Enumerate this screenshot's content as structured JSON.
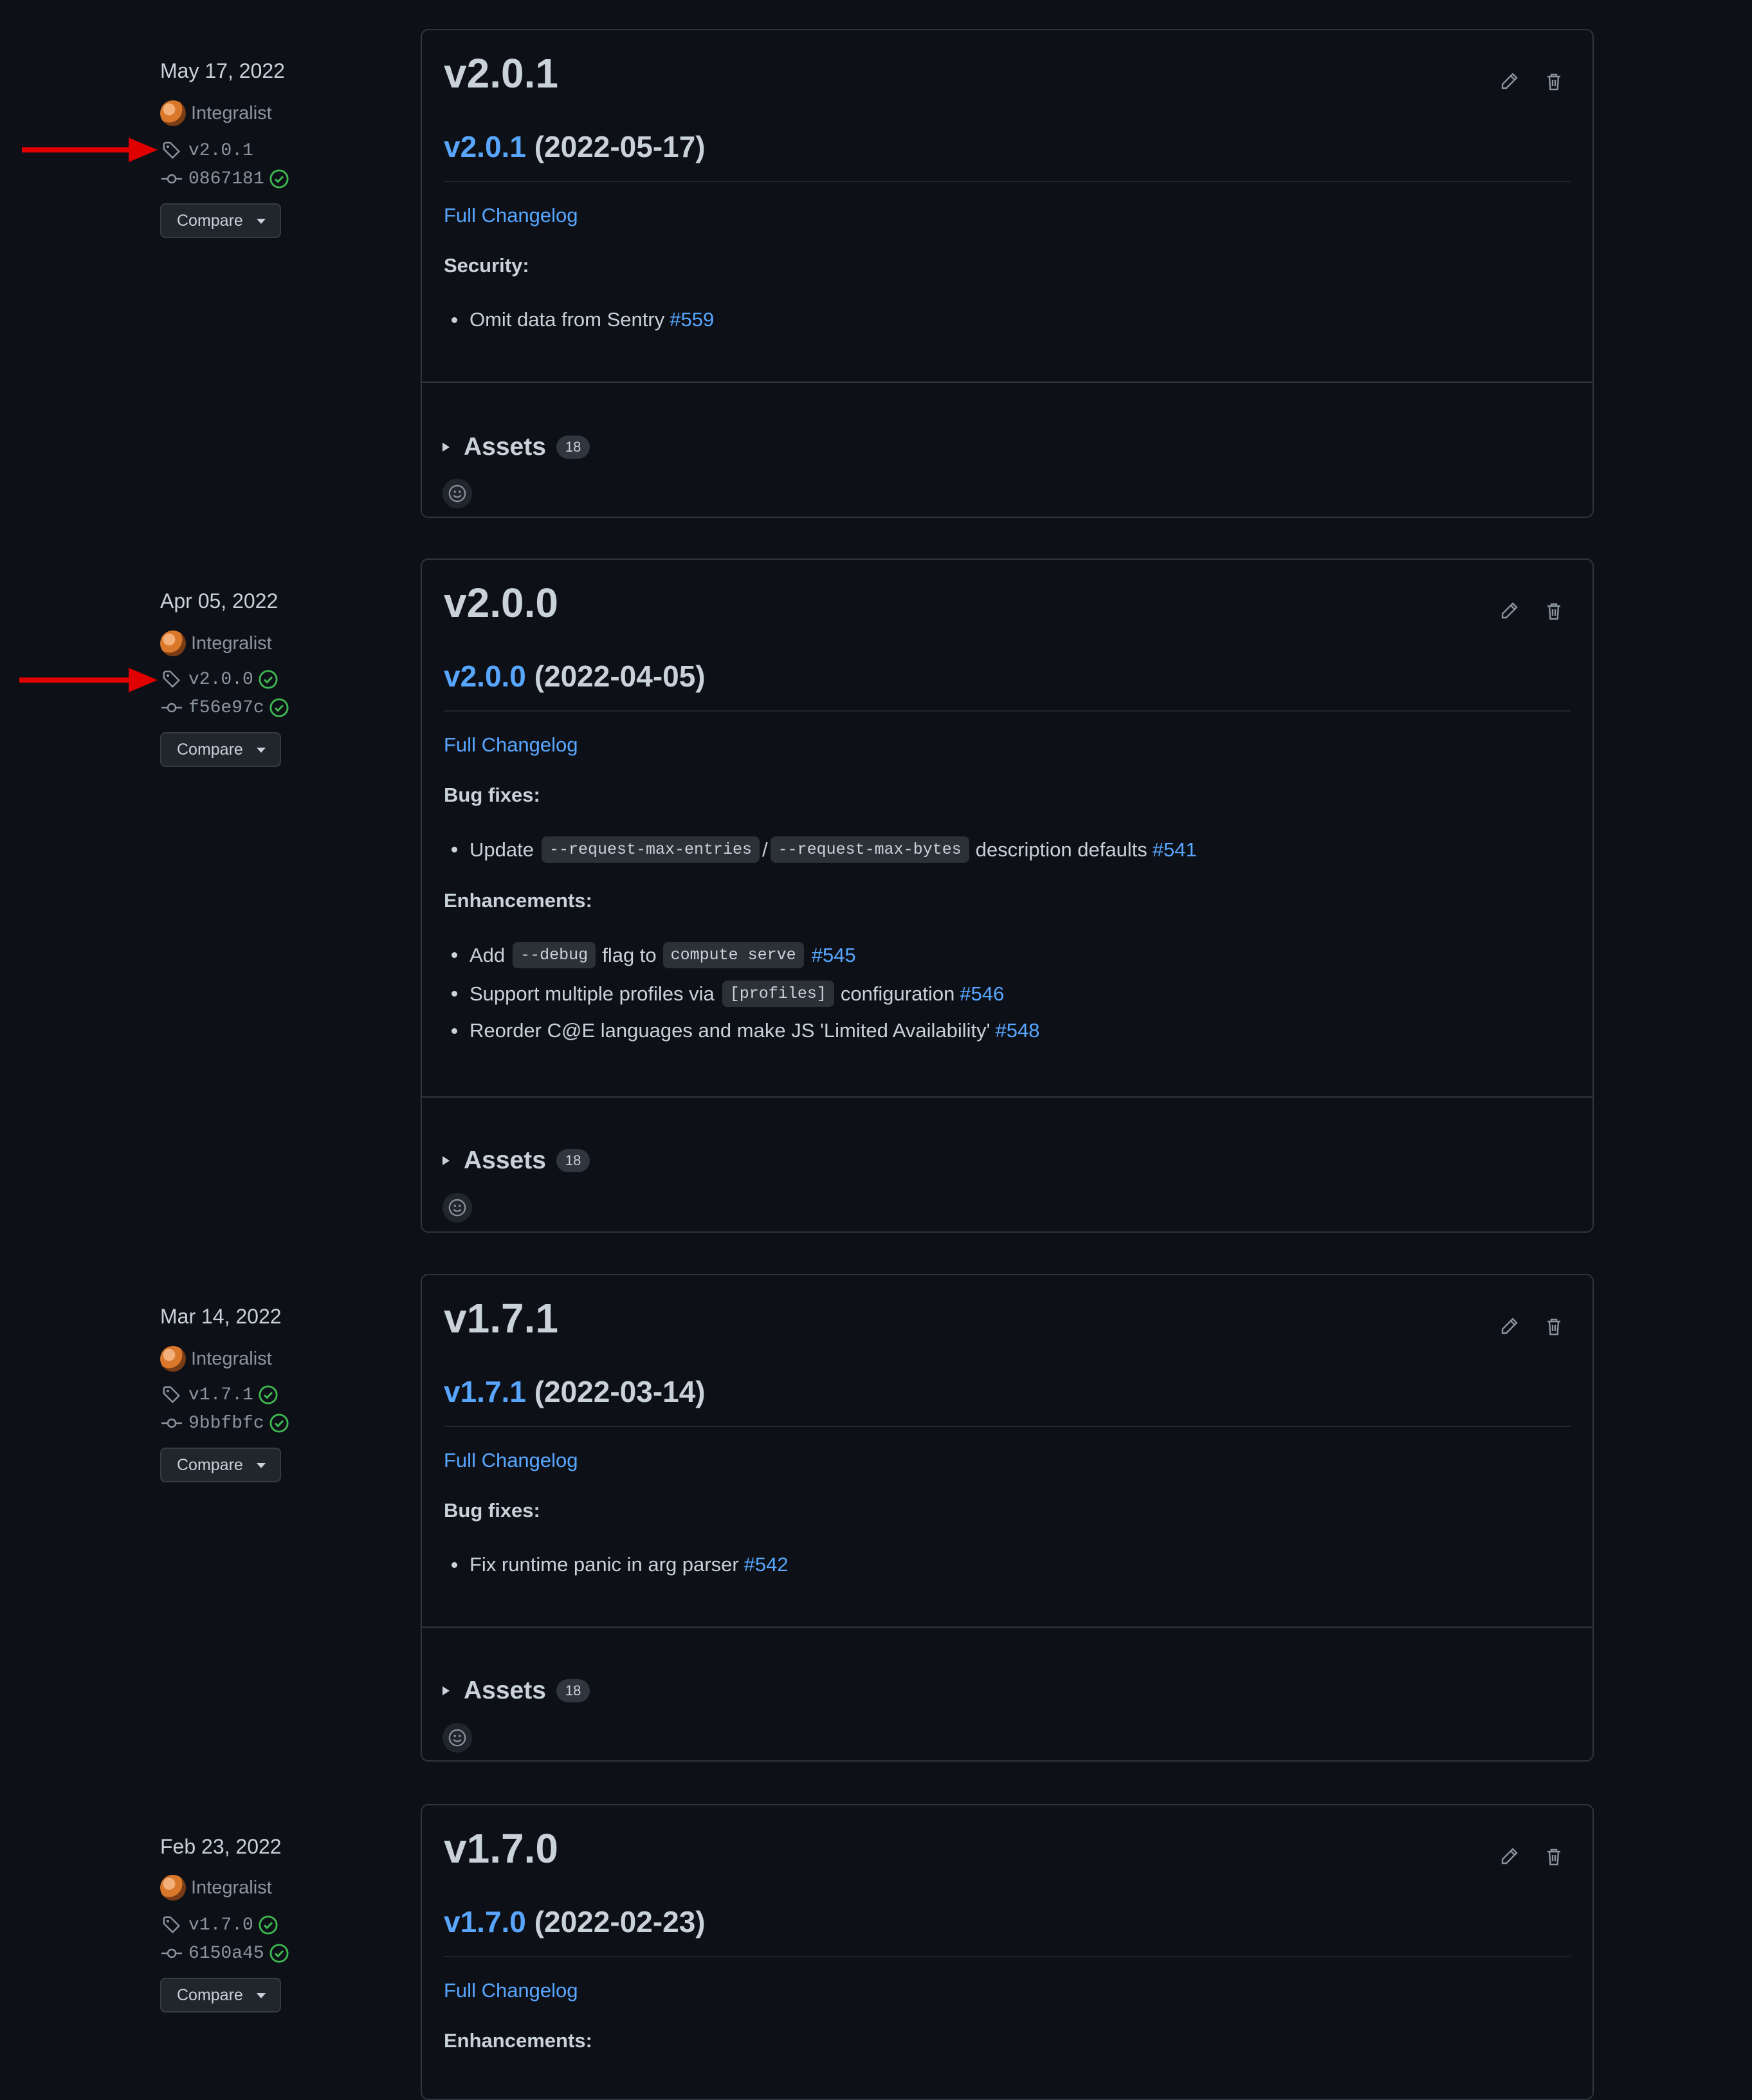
{
  "colors": {
    "background": "#0d1117",
    "link": "#58a6ff",
    "success": "#3fb950",
    "annotation_arrow": "#e00000"
  },
  "icons": {
    "tag": "tag-icon",
    "commit": "git-commit-icon",
    "verified": "check-circle-icon",
    "edit": "pencil-icon",
    "delete": "trash-icon",
    "reaction": "smiley-icon"
  },
  "releases": [
    {
      "date": "May 17, 2022",
      "author": "Integralist",
      "tag": "v2.0.1",
      "commit": "0867181",
      "compare": "Compare",
      "title": "v2.0.1",
      "heading_link": "v2.0.1",
      "heading_date": "(2022-05-17)",
      "full_changelog": "Full Changelog",
      "sections": [
        {
          "name": "Security:",
          "items": [
            {
              "text": "Omit data from Sentry",
              "ref": "#559"
            }
          ]
        }
      ],
      "assets_label": "Assets",
      "assets_count": "18"
    },
    {
      "date": "Apr 05, 2022",
      "author": "Integralist",
      "tag": "v2.0.0",
      "commit": "f56e97c",
      "compare": "Compare",
      "title": "v2.0.0",
      "heading_link": "v2.0.0",
      "heading_date": "(2022-04-05)",
      "full_changelog": "Full Changelog",
      "sections": [
        {
          "name": "Bug fixes:",
          "items": [
            {
              "pre": "Update",
              "code1": "--request-max-entries",
              "sep": "/",
              "code2": "--request-max-bytes",
              "post": "description defaults",
              "ref": "#541"
            }
          ]
        },
        {
          "name": "Enhancements:",
          "items": [
            {
              "pre": "Add",
              "code1": "--debug",
              "mid": "flag to",
              "code2": "compute serve",
              "ref": "#545"
            },
            {
              "pre": "Support multiple profiles via",
              "code1": "[profiles]",
              "post": "configuration",
              "ref": "#546"
            },
            {
              "text": "Reorder C@E languages and make JS 'Limited Availability'",
              "ref": "#548"
            }
          ]
        }
      ],
      "assets_label": "Assets",
      "assets_count": "18"
    },
    {
      "date": "Mar 14, 2022",
      "author": "Integralist",
      "tag": "v1.7.1",
      "commit": "9bbfbfc",
      "compare": "Compare",
      "title": "v1.7.1",
      "heading_link": "v1.7.1",
      "heading_date": "(2022-03-14)",
      "full_changelog": "Full Changelog",
      "sections": [
        {
          "name": "Bug fixes:",
          "items": [
            {
              "text": "Fix runtime panic in arg parser",
              "ref": "#542"
            }
          ]
        }
      ],
      "assets_label": "Assets",
      "assets_count": "18"
    },
    {
      "date": "Feb 23, 2022",
      "author": "Integralist",
      "tag": "v1.7.0",
      "commit": "6150a45",
      "compare": "Compare",
      "title": "v1.7.0",
      "heading_link": "v1.7.0",
      "heading_date": "(2022-02-23)",
      "full_changelog": "Full Changelog",
      "sections": [
        {
          "name": "Enhancements:",
          "items": []
        }
      ]
    }
  ]
}
